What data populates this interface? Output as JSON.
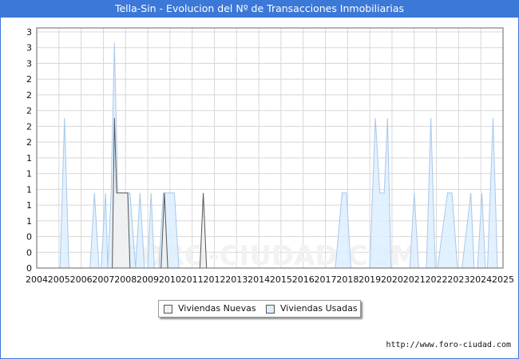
{
  "title": "Tella-Sin - Evolucion del Nº de Transacciones Inmobiliarias",
  "footer_url": "http://www.foro-ciudad.com",
  "watermark": "FORO-CIUDAD.COM",
  "colors": {
    "header": "#3c78d8",
    "nuevas_fill": "#f0f0f0",
    "nuevas_line": "#555555",
    "usadas_fill": "#ddeeff",
    "usadas_line": "#a8c8ea",
    "grid": "#d8d8d8"
  },
  "chart_data": {
    "type": "area",
    "x_axis": {
      "min": 2004,
      "max": 2025,
      "tick_labels": [
        "2004",
        "2005",
        "2006",
        "2007",
        "2008",
        "2009",
        "2010",
        "2011",
        "2012",
        "2013",
        "2014",
        "2015",
        "2016",
        "2017",
        "2018",
        "2019",
        "2020",
        "2021",
        "2022",
        "2023",
        "2024",
        "2025"
      ]
    },
    "y_axis": {
      "min": 0,
      "max": 3.2,
      "tick_labels": [
        "0",
        "0",
        "0",
        "1",
        "1",
        "1",
        "1",
        "1",
        "2",
        "2",
        "2",
        "2",
        "2",
        "3",
        "3",
        "3"
      ]
    },
    "grid": true,
    "legend_position": "bottom-center",
    "series": [
      {
        "name": "Viviendas Nuevas",
        "x": [
          2004,
          2007.4,
          2007.5,
          2007.6,
          2007.7,
          2007.8,
          2008.1,
          2008.2,
          2009.6,
          2009.75,
          2009.9,
          2011.35,
          2011.5,
          2011.65,
          2025
        ],
        "y": [
          0,
          0,
          2,
          1,
          1,
          1,
          1,
          0,
          0,
          1,
          0,
          0,
          1,
          0,
          0
        ]
      },
      {
        "name": "Viviendas Usadas",
        "x": [
          2004,
          2005.05,
          2005.25,
          2005.45,
          2006.4,
          2006.6,
          2006.8,
          2006.9,
          2007.1,
          2007.2,
          2007.35,
          2007.5,
          2007.65,
          2007.8,
          2008.2,
          2008.45,
          2008.65,
          2008.85,
          2009.0,
          2009.15,
          2009.3,
          2009.5,
          2009.7,
          2009.95,
          2010.2,
          2010.4,
          2010.65,
          2017.25,
          2017.45,
          2017.75,
          2017.95,
          2018.15,
          2019.0,
          2019.25,
          2019.45,
          2019.65,
          2019.8,
          2019.95,
          2020.2,
          2020.4,
          2020.8,
          2021.0,
          2021.2,
          2021.55,
          2021.75,
          2021.95,
          2022.05,
          2022.5,
          2022.7,
          2022.95,
          2023.15,
          2023.55,
          2023.7,
          2023.85,
          2024.05,
          2024.2,
          2024.3,
          2024.55,
          2024.75,
          2025
        ],
        "y": [
          0,
          0,
          2,
          0,
          0,
          1,
          0,
          0,
          1,
          0,
          1,
          3,
          1,
          1,
          1,
          0,
          1,
          0,
          0,
          1,
          0,
          0,
          1,
          1,
          1,
          0,
          0,
          0,
          0,
          1,
          1,
          0,
          0,
          2,
          1,
          1,
          2,
          0,
          0,
          0,
          0,
          1,
          0,
          0,
          2,
          0,
          0,
          1,
          1,
          0,
          0,
          1,
          0,
          0,
          1,
          0,
          0,
          2,
          0,
          0
        ]
      }
    ]
  }
}
